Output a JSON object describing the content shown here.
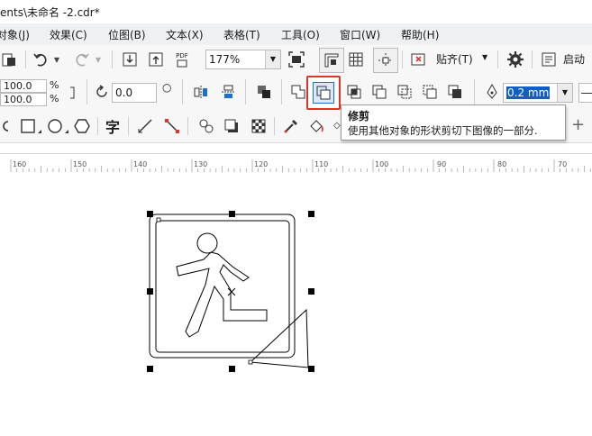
{
  "window": {
    "title": "ents\\未命名 -2.cdr*"
  },
  "menu": [
    "对象(J)",
    "效果(C)",
    "位图(B)",
    "文本(X)",
    "表格(T)",
    "工具(O)",
    "窗口(W)",
    "帮助(H)"
  ],
  "toolbar": {
    "zoom": "177%",
    "snap_label": "贴齐(T)",
    "launch_label": "启动",
    "pdf_label": "PDF"
  },
  "properties": {
    "scale_x": "100.0",
    "scale_y": "100.0",
    "pct": "%",
    "rotation": "0.0",
    "outline_width": "0.2 mm"
  },
  "tooltip": {
    "title": "修剪",
    "description": "使用其他对象的形状剪切下图像的一部分."
  },
  "ruler": {
    "labels": [
      "160",
      "150",
      "140",
      "130",
      "120",
      "110",
      "100",
      "90",
      "80",
      "70"
    ]
  },
  "colors": {
    "highlight": "#e0342b",
    "accent": "#1a6fd1",
    "selection": "#0f5fc4"
  },
  "icons": [
    "undo-icon",
    "redo-icon",
    "import-icon",
    "export-icon",
    "fullscreen-icon",
    "rulers-icon",
    "grid-icon",
    "guidelines-icon",
    "snap-icon",
    "gear-icon",
    "launch-icon",
    "mirror-icon",
    "trim-icon",
    "weld-icon",
    "pen-icon"
  ]
}
